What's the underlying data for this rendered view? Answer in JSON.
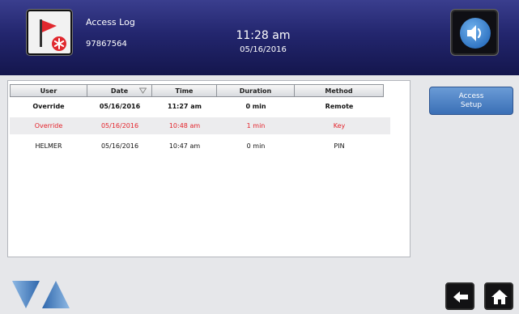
{
  "header": {
    "title": "Access Log",
    "device_id": "97867564",
    "time": "11:28 am",
    "date": "05/16/2016"
  },
  "icons": {
    "alarm_flag": "flag-alarm-icon",
    "sound": "speaker-icon",
    "sort": "sort-descending-icon",
    "scroll_down": "triangle-down-icon",
    "scroll_up": "triangle-up-icon",
    "back": "back-arrow-icon",
    "home": "home-icon"
  },
  "colors": {
    "header_top": "#3a3e8e",
    "header_bottom": "#14164d",
    "alarm_red": "#e4232b",
    "button_blue": "#4a7fc4",
    "arrow_blue": "#4a7fc0"
  },
  "table": {
    "columns": [
      "User",
      "Date",
      "Time",
      "Duration",
      "Method"
    ],
    "rows": [
      {
        "user": "Override",
        "date": "05/16/2016",
        "time": "11:27 am",
        "duration": "0 min",
        "method": "Remote"
      },
      {
        "user": "Override",
        "date": "05/16/2016",
        "time": "10:48 am",
        "duration": "1 min",
        "method": "Key"
      },
      {
        "user": "HELMER",
        "date": "05/16/2016",
        "time": "10:47 am",
        "duration": "0 min",
        "method": "PIN"
      }
    ]
  },
  "sidebar": {
    "access_setup_line1": "Access",
    "access_setup_line2": "Setup"
  }
}
